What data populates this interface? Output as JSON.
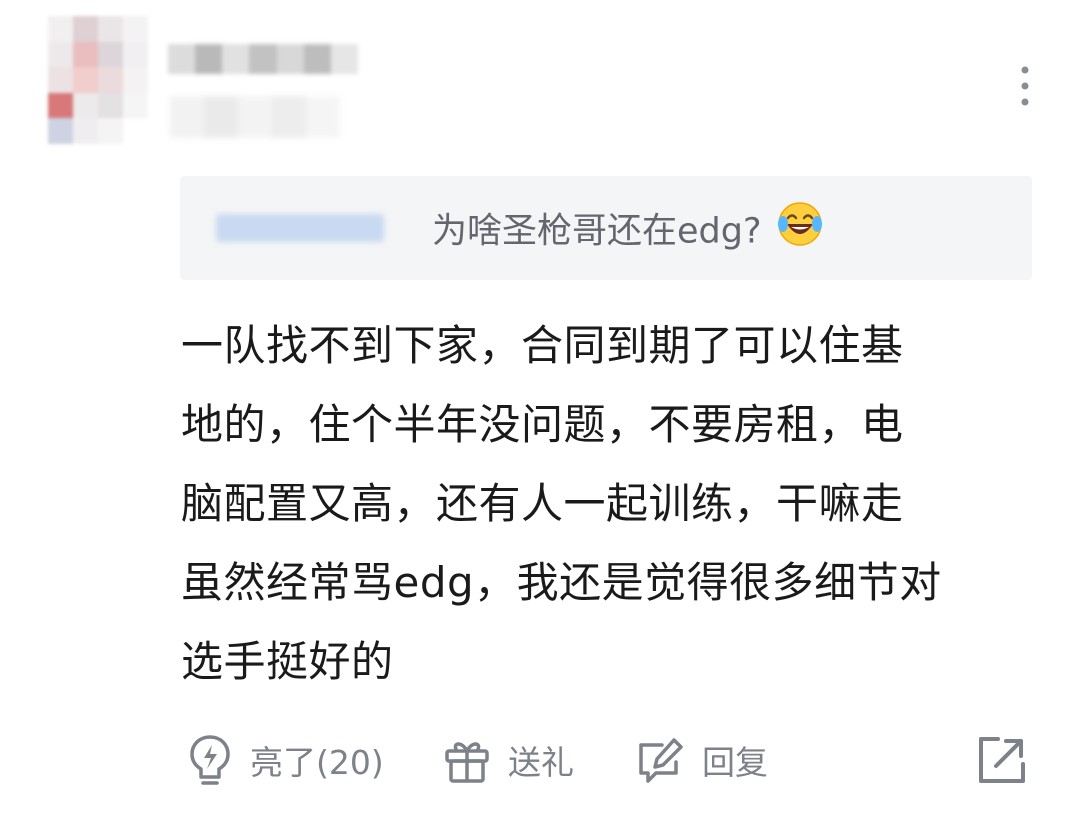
{
  "comment": {
    "quote": {
      "text": "为啥圣枪哥还在edg?",
      "emoji": "laughing-crying-emoji"
    },
    "body_lines": [
      "一队找不到下家，合同到期了可以住基",
      "地的，住个半年没问题，不要房租，电",
      "脑配置又高，还有人一起训练，干嘛走",
      "虽然经常骂edg，我还是觉得很多细节对",
      "选手挺好的"
    ]
  },
  "actions": {
    "like_label": "亮了(20)",
    "gift_label": "送礼",
    "reply_label": "回复"
  },
  "icons": {
    "more": "more-vertical-icon",
    "like": "lightning-bulb-icon",
    "gift": "gift-icon",
    "reply": "reply-pencil-icon",
    "share": "share-arrow-icon"
  },
  "colors": {
    "action_gray": "#7d8189",
    "quote_bg": "#f4f5f7",
    "quote_text": "#63666d",
    "body_text": "#1a1a1a"
  }
}
